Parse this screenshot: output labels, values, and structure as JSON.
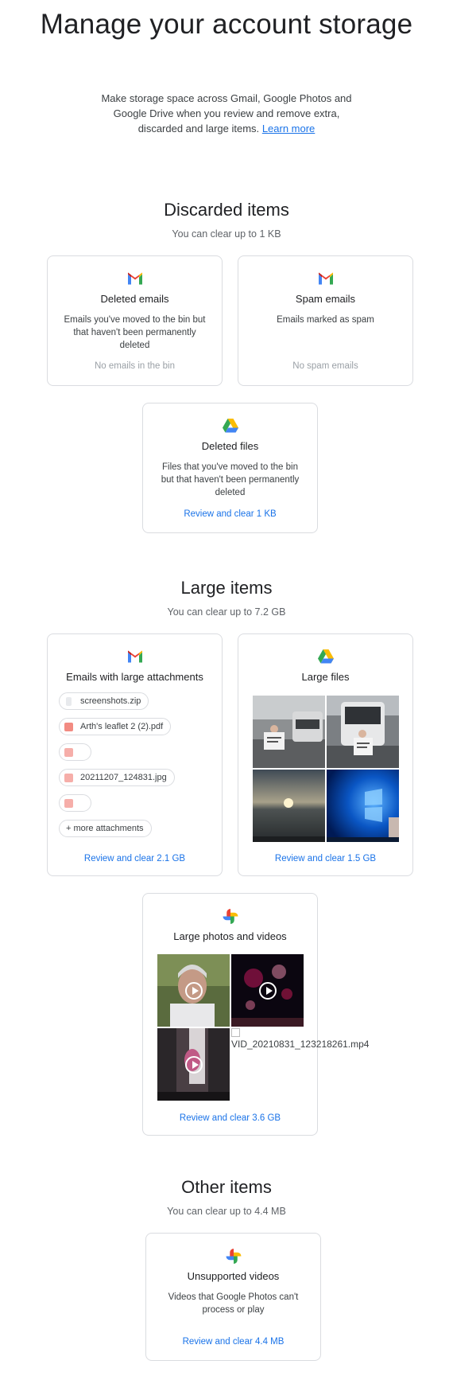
{
  "header": {
    "title": "Manage your account storage",
    "intro": "Make storage space across Gmail, Google Photos and Google Drive when you review and remove extra, discarded and large items.",
    "learn_more": "Learn more"
  },
  "discarded": {
    "title": "Discarded items",
    "subtitle": "You can clear up to 1 KB",
    "deleted_emails": {
      "title": "Deleted emails",
      "desc": "Emails you've moved to the bin but that haven't been permanently deleted",
      "status": "No emails in the bin",
      "icon": "gmail-icon"
    },
    "spam_emails": {
      "title": "Spam emails",
      "desc": "Emails marked as spam",
      "status": "No spam emails",
      "icon": "gmail-icon"
    },
    "deleted_files": {
      "title": "Deleted files",
      "desc": "Files that you've moved to the bin but that haven't been permanently deleted",
      "action": "Review and clear 1 KB",
      "icon": "drive-icon"
    }
  },
  "large": {
    "title": "Large items",
    "subtitle": "You can clear up to 7.2 GB",
    "attachments": {
      "title": "Emails with large attachments",
      "chips": [
        "screenshots.zip",
        "Arth's leaflet 2 (2).pdf",
        "",
        "20211207_124831.jpg",
        ""
      ],
      "more": "+ more attachments",
      "action": "Review and clear 2.1 GB",
      "icon": "gmail-icon"
    },
    "files": {
      "title": "Large files",
      "action": "Review and clear 1.5 GB",
      "icon": "drive-icon"
    },
    "photos": {
      "title": "Large photos and videos",
      "broken_caption": "VID_20210831_123218261.mp4",
      "action": "Review and clear 3.6 GB",
      "icon": "photos-icon"
    }
  },
  "other": {
    "title": "Other items",
    "subtitle": "You can clear up to 4.4 MB",
    "unsupported": {
      "title": "Unsupported videos",
      "desc": "Videos that Google Photos can't process or play",
      "action": "Review and clear 4.4 MB",
      "icon": "photos-icon"
    }
  },
  "colors": {
    "link": "#1a73e8",
    "border": "#dadce0",
    "muted": "#9aa0a6"
  }
}
